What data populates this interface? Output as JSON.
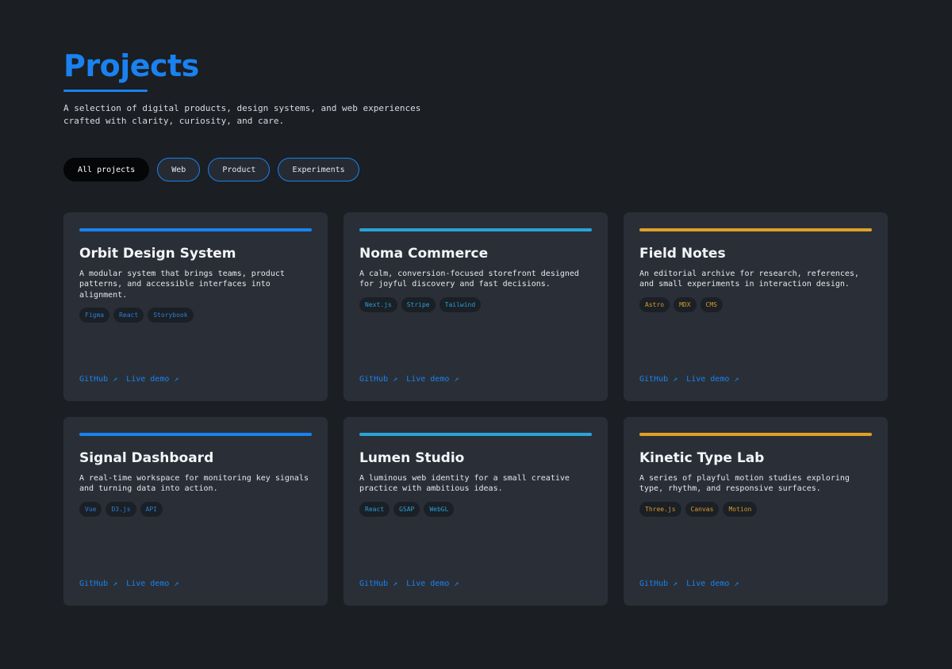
{
  "header": {
    "title": "Projects",
    "intro": "A selection of digital products, design systems, and web experiences crafted with clarity, curiosity, and care."
  },
  "filters": [
    {
      "label": "All projects",
      "active": true
    },
    {
      "label": "Web",
      "active": false
    },
    {
      "label": "Product",
      "active": false
    },
    {
      "label": "Experiments",
      "active": false
    }
  ],
  "colors": {
    "background": "#1b1e23",
    "card": "#2a2f37",
    "primary_blue": "#1a82f0",
    "cyan": "#2ba3d8",
    "amber": "#e0a028",
    "tag_blue_text": "#2f7fd0",
    "tag_cyan_text": "#2b9ed0",
    "tag_amber_text": "#d69a2a"
  },
  "projects": [
    {
      "title": "Orbit Design System",
      "description": "A modular system that brings teams, product patterns, and accessible interfaces into alignment.",
      "accent": "#1a82f0",
      "tag_color": "#2f7fd0",
      "tags": [
        "Figma",
        "React",
        "Storybook"
      ],
      "github": "GitHub ↗",
      "demo": "Live demo ↗"
    },
    {
      "title": "Noma Commerce",
      "description": "A calm, conversion-focused storefront designed for joyful discovery and fast decisions.",
      "accent": "#2ba3d8",
      "tag_color": "#2b9ed0",
      "tags": [
        "Next.js",
        "Stripe",
        "Tailwind"
      ],
      "github": "GitHub ↗",
      "demo": "Live demo ↗"
    },
    {
      "title": "Field Notes",
      "description": "An editorial archive for research, references, and small experiments in interaction design.",
      "accent": "#e0a028",
      "tag_color": "#d69a2a",
      "tags": [
        "Astro",
        "MDX",
        "CMS"
      ],
      "github": "GitHub ↗",
      "demo": "Live demo ↗"
    },
    {
      "title": "Signal Dashboard",
      "description": "A real-time workspace for monitoring key signals and turning data into action.",
      "accent": "#1a82f0",
      "tag_color": "#2f7fd0",
      "tags": [
        "Vue",
        "D3.js",
        "API"
      ],
      "github": "GitHub ↗",
      "demo": "Live demo ↗"
    },
    {
      "title": "Lumen Studio",
      "description": "A luminous web identity for a small creative practice with ambitious ideas.",
      "accent": "#2ba3d8",
      "tag_color": "#2b9ed0",
      "tags": [
        "React",
        "GSAP",
        "WebGL"
      ],
      "github": "GitHub ↗",
      "demo": "Live demo ↗"
    },
    {
      "title": "Kinetic Type Lab",
      "description": "A series of playful motion studies exploring type, rhythm, and responsive surfaces.",
      "accent": "#e0a028",
      "tag_color": "#d69a2a",
      "tags": [
        "Three.js",
        "Canvas",
        "Motion"
      ],
      "github": "GitHub ↗",
      "demo": "Live demo ↗"
    }
  ]
}
